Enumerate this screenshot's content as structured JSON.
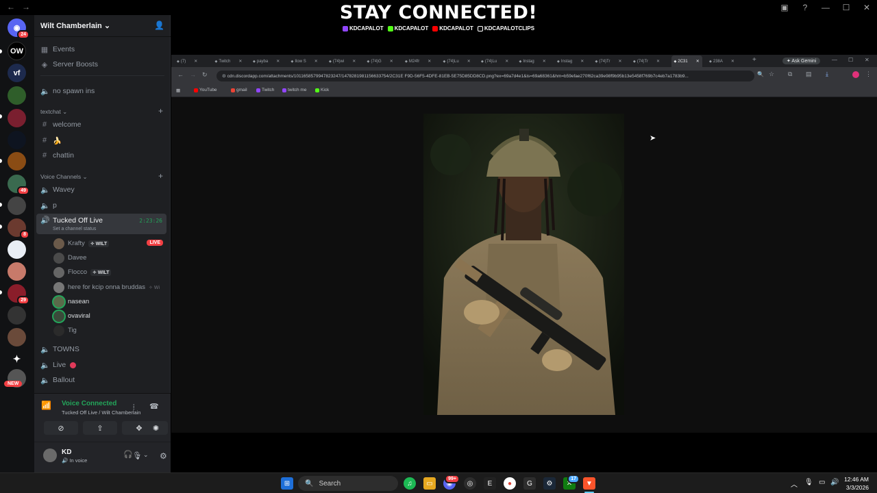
{
  "banner": {
    "title": "STAY CONNECTED!",
    "handles": [
      "KDCAPALOT",
      "KDCAPALOT",
      "KDCAPALOT",
      "KDCAPALOTCLIPS"
    ]
  },
  "guild": {
    "name": "Wilt Chamberlain",
    "top_items": [
      "Events",
      "Server Boosts"
    ],
    "channels": {
      "no_spawn": "no spawn ins",
      "text_category": "textchat",
      "text": [
        "welcome",
        "🍌",
        "chattin"
      ],
      "voice_category": "Voice Channels",
      "voice_before": [
        "Wavey",
        "p"
      ],
      "live_channel": "Tucked Off Live",
      "live_timer": "2:23:26",
      "live_status": "Set a channel status",
      "live_users": [
        {
          "name": "Krafty",
          "tag": "WILT",
          "live": "LIVE"
        },
        {
          "name": "Davee"
        },
        {
          "name": "Flocco",
          "tag": "WILT"
        },
        {
          "name": "here for kcip onna bruddas",
          "tag": "Wi"
        },
        {
          "name": "nasean"
        },
        {
          "name": "ovaviral"
        },
        {
          "name": "Tig"
        }
      ],
      "voice_after": [
        "TOWNS",
        "Live",
        "Ballout"
      ]
    }
  },
  "rail": {
    "badges": [
      "24",
      "49",
      "8",
      "29"
    ],
    "labels": [
      "OW",
      "vf"
    ],
    "new_label": "NEW"
  },
  "voice": {
    "status": "Voice Connected",
    "location": "Tucked Off Live / Wilt Chamberlain"
  },
  "user": {
    "name": "KD",
    "status": "In voice"
  },
  "browser": {
    "tabs": [
      "(7)",
      "Twitch",
      "payba",
      "Ilow S",
      "(74)wi",
      "(74)G",
      "M24fr",
      "(74)Lu",
      "(74)Lu",
      "Instag",
      "Instag",
      "(74)Tr",
      "(74)Tr",
      "2C31",
      "238A"
    ],
    "ask_gemini": "Ask Gemini",
    "url": "cdn.discordapp.com/attachments/1011658579947823247/1478281981156633754/2C31E F9D-56F5-4DFE-81EB-5E75D85DD8CD.png?ex=69a7d4e1&is=69a68361&hm=b59efae270f62ca39e98f9b95b13e5458f769b7c4eb7a1783b9...",
    "bookmarks": [
      "YouTube",
      "gmail",
      "Twitch",
      "twitch me",
      "Kick"
    ]
  },
  "taskbar": {
    "search": "Search",
    "time": "12:46 AM",
    "date": "3/3/2026",
    "discord_badge": "99+",
    "xbox_badge": "17"
  }
}
